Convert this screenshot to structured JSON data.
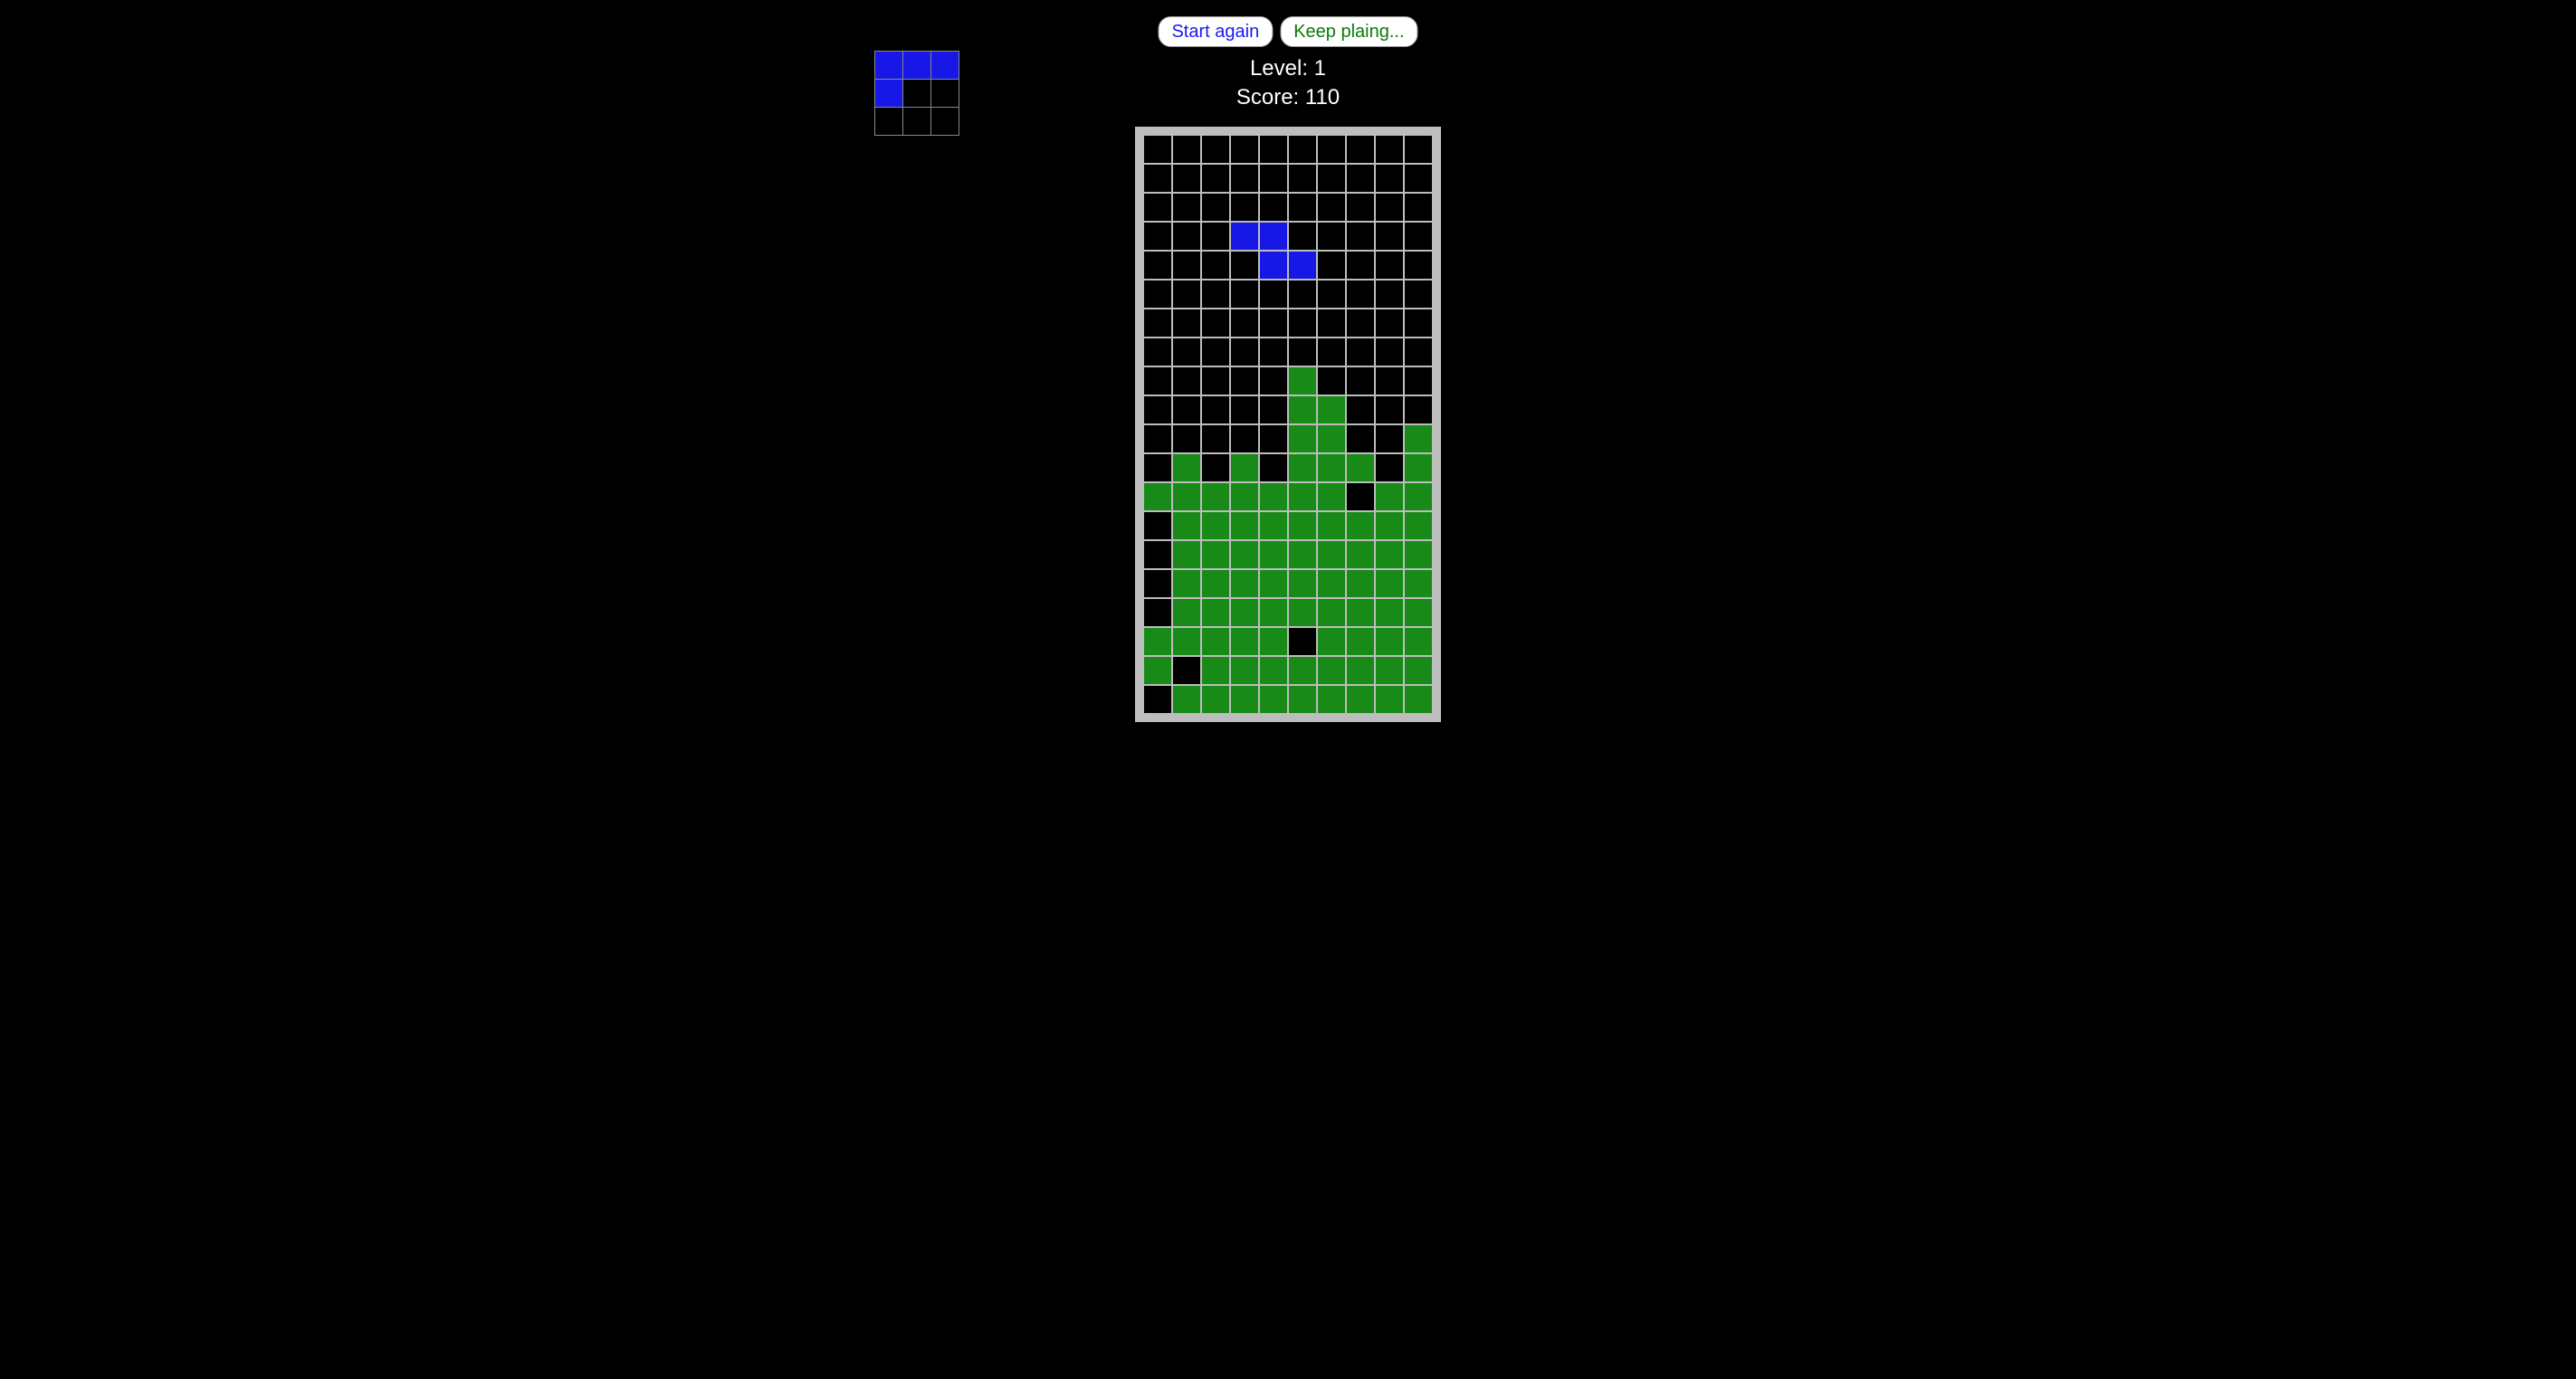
{
  "controls": {
    "start_again_label": "Start again",
    "keep_playing_label": "Keep plaing..."
  },
  "status": {
    "level_label": "Level: ",
    "level_value": "1",
    "score_label": "Score: ",
    "score_value": "110"
  },
  "colors": {
    "blue": "#1717e6",
    "green": "#188a18",
    "board_bg": "#bdbdbd",
    "empty": "#000000"
  },
  "board": {
    "cols": 10,
    "rows": 20,
    "cells": [
      [
        0,
        0,
        0,
        0,
        0,
        0,
        0,
        0,
        0,
        0
      ],
      [
        0,
        0,
        0,
        0,
        0,
        0,
        0,
        0,
        0,
        0
      ],
      [
        0,
        0,
        0,
        0,
        0,
        0,
        0,
        0,
        0,
        0
      ],
      [
        0,
        0,
        0,
        1,
        1,
        0,
        0,
        0,
        0,
        0
      ],
      [
        0,
        0,
        0,
        0,
        1,
        1,
        0,
        0,
        0,
        0
      ],
      [
        0,
        0,
        0,
        0,
        0,
        0,
        0,
        0,
        0,
        0
      ],
      [
        0,
        0,
        0,
        0,
        0,
        0,
        0,
        0,
        0,
        0
      ],
      [
        0,
        0,
        0,
        0,
        0,
        0,
        0,
        0,
        0,
        0
      ],
      [
        0,
        0,
        0,
        0,
        0,
        2,
        0,
        0,
        0,
        0
      ],
      [
        0,
        0,
        0,
        0,
        0,
        2,
        2,
        0,
        0,
        0
      ],
      [
        0,
        0,
        0,
        0,
        0,
        2,
        2,
        0,
        0,
        2
      ],
      [
        0,
        2,
        0,
        2,
        0,
        2,
        2,
        2,
        0,
        2
      ],
      [
        2,
        2,
        2,
        2,
        2,
        2,
        2,
        0,
        2,
        2
      ],
      [
        0,
        2,
        2,
        2,
        2,
        2,
        2,
        2,
        2,
        2
      ],
      [
        0,
        2,
        2,
        2,
        2,
        2,
        2,
        2,
        2,
        2
      ],
      [
        0,
        2,
        2,
        2,
        2,
        2,
        2,
        2,
        2,
        2
      ],
      [
        0,
        2,
        2,
        2,
        2,
        2,
        2,
        2,
        2,
        2
      ],
      [
        2,
        2,
        2,
        2,
        2,
        0,
        2,
        2,
        2,
        2
      ],
      [
        2,
        0,
        2,
        2,
        2,
        2,
        2,
        2,
        2,
        2
      ],
      [
        0,
        2,
        2,
        2,
        2,
        2,
        2,
        2,
        2,
        2
      ]
    ]
  },
  "preview": {
    "cols": 3,
    "rows": 3,
    "cells": [
      [
        1,
        1,
        1
      ],
      [
        1,
        0,
        0
      ],
      [
        0,
        0,
        0
      ]
    ]
  }
}
